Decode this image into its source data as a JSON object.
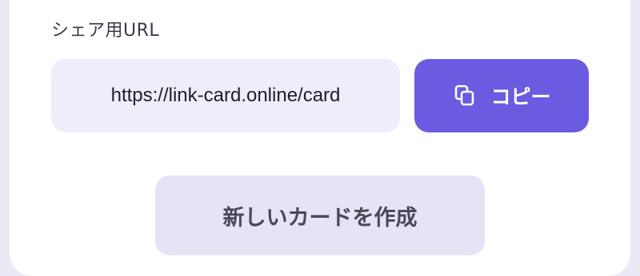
{
  "share": {
    "label": "シェア用URL",
    "url": "https://link-card.online/card",
    "copy_label": "コピー",
    "copy_icon": "copy-icon"
  },
  "actions": {
    "create_label": "新しいカードを作成"
  },
  "colors": {
    "accent": "#6b5be0",
    "field_bg": "#f0ecfa",
    "secondary_bg": "#e7e2f6",
    "page_bg": "#ece9f6"
  }
}
